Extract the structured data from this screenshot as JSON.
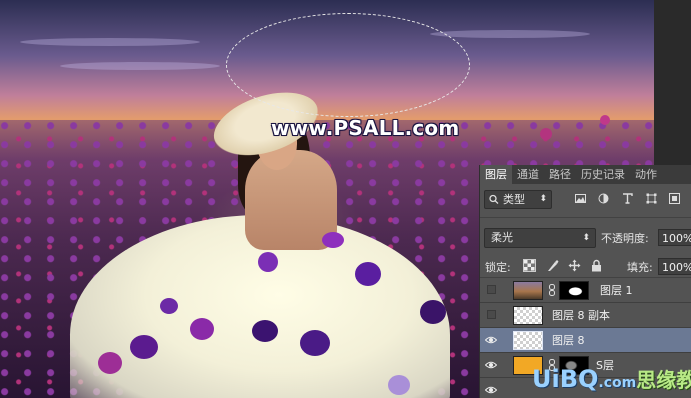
{
  "canvas": {
    "watermark_text": "www.PSALL.com"
  },
  "layers_panel": {
    "tabs": [
      {
        "label": "图层",
        "active": true
      },
      {
        "label": "通道",
        "active": false
      },
      {
        "label": "路径",
        "active": false
      },
      {
        "label": "历史记录",
        "active": false
      },
      {
        "label": "动作",
        "active": false
      }
    ],
    "filter": {
      "label": "类型",
      "icon": "search-icon"
    },
    "filter_icons": [
      "image-filter-icon",
      "adjustment-filter-icon",
      "type-filter-icon",
      "shape-filter-icon",
      "smart-object-filter-icon"
    ],
    "blend_mode": "柔光",
    "opacity_label": "不透明度:",
    "opacity_value": "100%",
    "lock_label": "锁定:",
    "lock_icons": [
      "lock-transparent-pixels-icon",
      "lock-image-pixels-icon",
      "lock-position-icon",
      "lock-all-icon"
    ],
    "fill_label": "填充:",
    "fill_value": "100%",
    "layers": [
      {
        "name": "图层 1",
        "visible": false,
        "thumb": "photo",
        "has_mask": true
      },
      {
        "name": "图层 8 副本",
        "visible": false,
        "thumb": "transparent",
        "has_mask": false
      },
      {
        "name": "图层 8",
        "visible": true,
        "thumb": "transparent",
        "has_mask": false,
        "selected": true
      },
      {
        "name": "S层",
        "visible": true,
        "thumb": "orange-fill",
        "has_mask": true
      }
    ]
  },
  "site_logo": {
    "prefix": "UiBQ",
    "suffix": ".com",
    "cn_text": "思缘教程"
  },
  "colors": {
    "panel_bg": "#535353",
    "tab_bar_bg": "#3b3b3b",
    "selected_layer": "#6b7994",
    "fill_swatch": "#f2a825"
  }
}
